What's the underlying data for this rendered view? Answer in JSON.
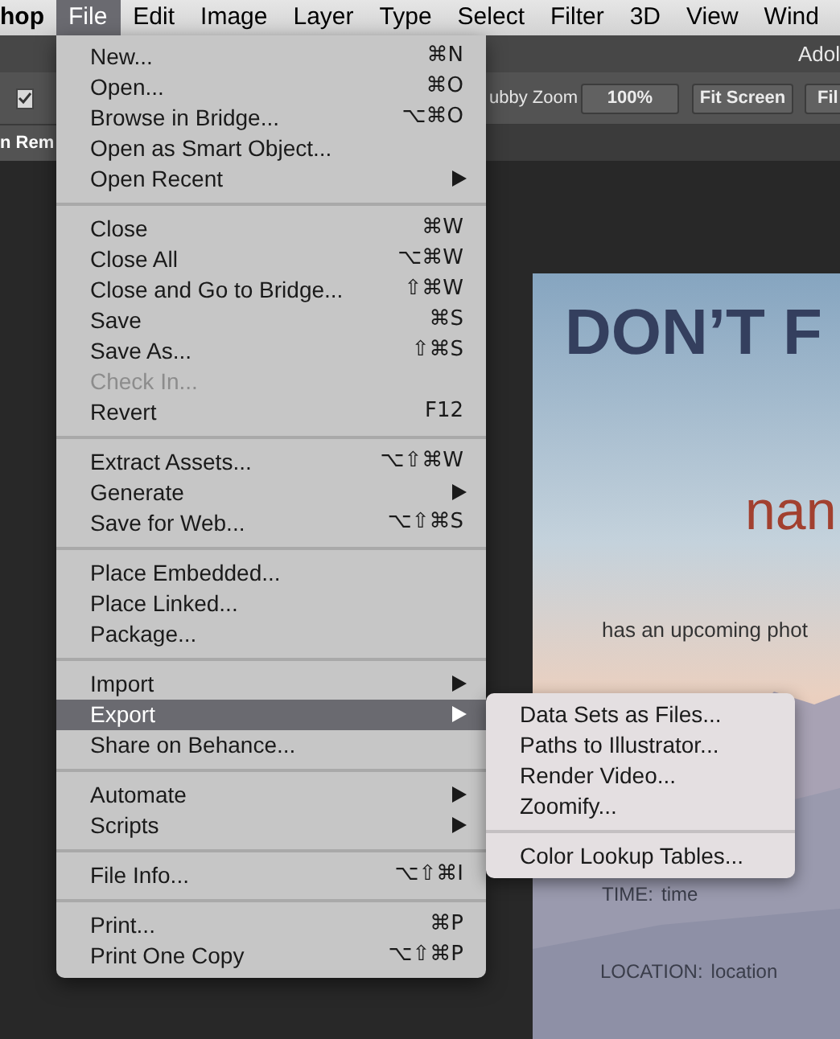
{
  "menubar": {
    "items": [
      {
        "label": "hop",
        "kind": "app",
        "selected": false
      },
      {
        "label": "File",
        "kind": "menu",
        "selected": true
      },
      {
        "label": "Edit",
        "kind": "menu",
        "selected": false
      },
      {
        "label": "Image",
        "kind": "menu",
        "selected": false
      },
      {
        "label": "Layer",
        "kind": "menu",
        "selected": false
      },
      {
        "label": "Type",
        "kind": "menu",
        "selected": false
      },
      {
        "label": "Select",
        "kind": "menu",
        "selected": false
      },
      {
        "label": "Filter",
        "kind": "menu",
        "selected": false
      },
      {
        "label": "3D",
        "kind": "menu",
        "selected": false
      },
      {
        "label": "View",
        "kind": "menu",
        "selected": false
      },
      {
        "label": "Wind",
        "kind": "menu",
        "selected": false
      }
    ]
  },
  "app_title": "Adol",
  "options_bar": {
    "checkbox": {
      "checked": true
    },
    "label": "ubby Zoom",
    "buttons": [
      "100%",
      "Fit Screen",
      "Fil"
    ]
  },
  "document_tab": "n Rem",
  "file_menu": {
    "groups": [
      [
        {
          "label": "New...",
          "shortcut": "⌘N",
          "submenu": false,
          "disabled": false,
          "selected": false
        },
        {
          "label": "Open...",
          "shortcut": "⌘O",
          "submenu": false,
          "disabled": false,
          "selected": false
        },
        {
          "label": "Browse in Bridge...",
          "shortcut": "⌥⌘O",
          "submenu": false,
          "disabled": false,
          "selected": false
        },
        {
          "label": "Open as Smart Object...",
          "submenu": false,
          "disabled": false,
          "selected": false
        },
        {
          "label": "Open Recent",
          "submenu": true,
          "disabled": false,
          "selected": false
        }
      ],
      [
        {
          "label": "Close",
          "shortcut": "⌘W",
          "submenu": false,
          "disabled": false,
          "selected": false
        },
        {
          "label": "Close All",
          "shortcut": "⌥⌘W",
          "submenu": false,
          "disabled": false,
          "selected": false
        },
        {
          "label": "Close and Go to Bridge...",
          "shortcut": "⇧⌘W",
          "submenu": false,
          "disabled": false,
          "selected": false
        },
        {
          "label": "Save",
          "shortcut": "⌘S",
          "submenu": false,
          "disabled": false,
          "selected": false
        },
        {
          "label": "Save As...",
          "shortcut": "⇧⌘S",
          "submenu": false,
          "disabled": false,
          "selected": false
        },
        {
          "label": "Check In...",
          "submenu": false,
          "disabled": true,
          "selected": false
        },
        {
          "label": "Revert",
          "shortcut": "F12",
          "submenu": false,
          "disabled": false,
          "selected": false
        }
      ],
      [
        {
          "label": "Extract Assets...",
          "shortcut": "⌥⇧⌘W",
          "submenu": false,
          "disabled": false,
          "selected": false
        },
        {
          "label": "Generate",
          "submenu": true,
          "disabled": false,
          "selected": false
        },
        {
          "label": "Save for Web...",
          "shortcut": "⌥⇧⌘S",
          "submenu": false,
          "disabled": false,
          "selected": false
        }
      ],
      [
        {
          "label": "Place Embedded...",
          "submenu": false,
          "disabled": false,
          "selected": false
        },
        {
          "label": "Place Linked...",
          "submenu": false,
          "disabled": false,
          "selected": false
        },
        {
          "label": "Package...",
          "submenu": false,
          "disabled": false,
          "selected": false
        }
      ],
      [
        {
          "label": "Import",
          "submenu": true,
          "disabled": false,
          "selected": false
        },
        {
          "label": "Export",
          "submenu": true,
          "disabled": false,
          "selected": true
        },
        {
          "label": "Share on Behance...",
          "submenu": false,
          "disabled": false,
          "selected": false
        }
      ],
      [
        {
          "label": "Automate",
          "submenu": true,
          "disabled": false,
          "selected": false
        },
        {
          "label": "Scripts",
          "submenu": true,
          "disabled": false,
          "selected": false
        }
      ],
      [
        {
          "label": "File Info...",
          "shortcut": "⌥⇧⌘I",
          "submenu": false,
          "disabled": false,
          "selected": false
        }
      ],
      [
        {
          "label": "Print...",
          "shortcut": "⌘P",
          "submenu": false,
          "disabled": false,
          "selected": false
        },
        {
          "label": "Print One Copy",
          "shortcut": "⌥⇧⌘P",
          "submenu": false,
          "disabled": false,
          "selected": false
        }
      ]
    ]
  },
  "export_submenu": {
    "groups": [
      [
        "Data Sets as Files...",
        "Paths to Illustrator...",
        "Render Video...",
        "Zoomify..."
      ],
      [
        "Color Lookup Tables..."
      ]
    ]
  },
  "document": {
    "headline": "DON’T F",
    "name": "nan",
    "subtitle": "has an upcoming phot",
    "time_label": "TIME:",
    "time_value": "time",
    "location_label": "LOCATION:",
    "location_value": "location"
  }
}
